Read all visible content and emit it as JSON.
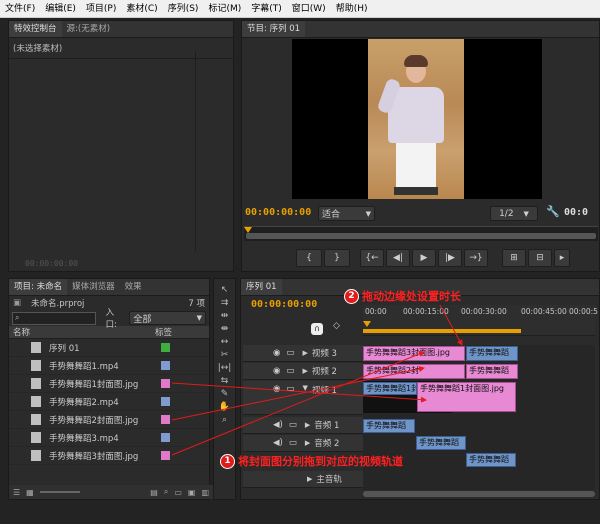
{
  "menu": [
    "文件(F)",
    "编辑(E)",
    "项目(P)",
    "素材(C)",
    "序列(S)",
    "标记(M)",
    "字幕(T)",
    "窗口(W)",
    "帮助(H)"
  ],
  "effect_controls": {
    "tab1": "特效控制台",
    "tab2": "源:(无素材)",
    "placeholder": "(未选择素材)",
    "timecode": "00:00:00:00"
  },
  "program": {
    "tab": "节目: 序列 01",
    "timecode": "00:00:00:00",
    "fit": "适合",
    "quality": "1/2",
    "end_timecode": "00:0"
  },
  "project": {
    "tabs": [
      "项目: 未命名",
      "媒体浏览器",
      "效果"
    ],
    "filename": "未命名.prproj",
    "count": "7 项",
    "entry_label": "入口:",
    "entry_value": "全部",
    "col_name": "名称",
    "col_label": "标签",
    "items": [
      {
        "name": "序列 01",
        "color": "#3fae3f"
      },
      {
        "name": "手势舞舞蹈1.mp4",
        "color": "#7f9bd0"
      },
      {
        "name": "手势舞舞蹈1封面图.jpg",
        "color": "#e07ac8"
      },
      {
        "name": "手势舞舞蹈2.mp4",
        "color": "#7f9bd0"
      },
      {
        "name": "手势舞舞蹈2封面图.jpg",
        "color": "#e07ac8"
      },
      {
        "name": "手势舞舞蹈3.mp4",
        "color": "#7f9bd0"
      },
      {
        "name": "手势舞舞蹈3封面图.jpg",
        "color": "#e07ac8"
      }
    ]
  },
  "timeline": {
    "tab": "序列 01",
    "timecode": "00:00:00:00",
    "ruler": [
      "00:00",
      "00:00:15:00",
      "00:00:30:00",
      "00:00:45:00",
      "00:00:5"
    ],
    "tracks": {
      "v3": "视频 3",
      "v2": "视频 2",
      "v1": "视频 1",
      "a1": "音频 1",
      "a2": "音频 2",
      "master": "主音轨"
    },
    "clips": {
      "v3_a": "手势舞舞蹈3封面图.jpg",
      "v3_b": "手势舞舞蹈",
      "v2_a": "手势舞舞蹈2封",
      "v2_b": "手势舞舞蹈",
      "v1_a": "手势舞舞蹈1封",
      "v1_b": "手势舞舞蹈1封面图.jpg",
      "a1_a": "手势舞舞蹈",
      "a2_a": "手势舞舞蹈",
      "a2_b": "手势舞舞蹈"
    }
  },
  "annotations": {
    "n1": "1",
    "text1": "将封面图分别拖到对应的视频轨道",
    "n2": "2",
    "text2": "拖动边缘处设置时长"
  }
}
